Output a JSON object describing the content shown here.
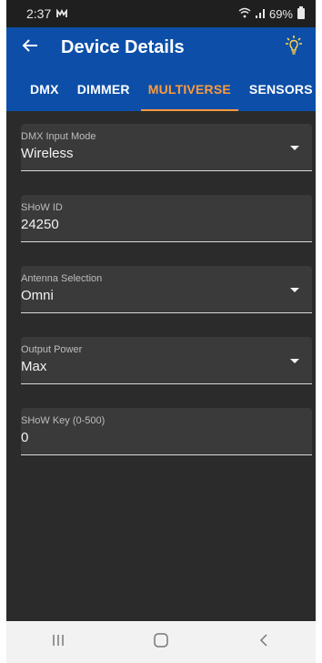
{
  "status_bar": {
    "time": "2:37",
    "notification_icon": "m-logo-icon",
    "battery": "69%"
  },
  "app_bar": {
    "title": "Device Details"
  },
  "tabs": [
    {
      "label": "DMX",
      "active": false
    },
    {
      "label": "DIMMER",
      "active": false
    },
    {
      "label": "MULTIVERSE",
      "active": true
    },
    {
      "label": "SENSORS",
      "active": false
    }
  ],
  "fields": [
    {
      "label": "DMX Input Mode",
      "value": "Wireless",
      "dropdown": true
    },
    {
      "label": "SHoW ID",
      "value": "24250",
      "dropdown": false
    },
    {
      "label": "Antenna Selection",
      "value": "Omni",
      "dropdown": true
    },
    {
      "label": "Output Power",
      "value": "Max",
      "dropdown": true
    },
    {
      "label": "SHoW Key (0-500)",
      "value": "0",
      "dropdown": false
    }
  ],
  "colors": {
    "accent": "#ff9a3c",
    "app_bar": "#0d4fa8",
    "background": "#2b2b2b",
    "field_background": "#3a3a3a"
  }
}
